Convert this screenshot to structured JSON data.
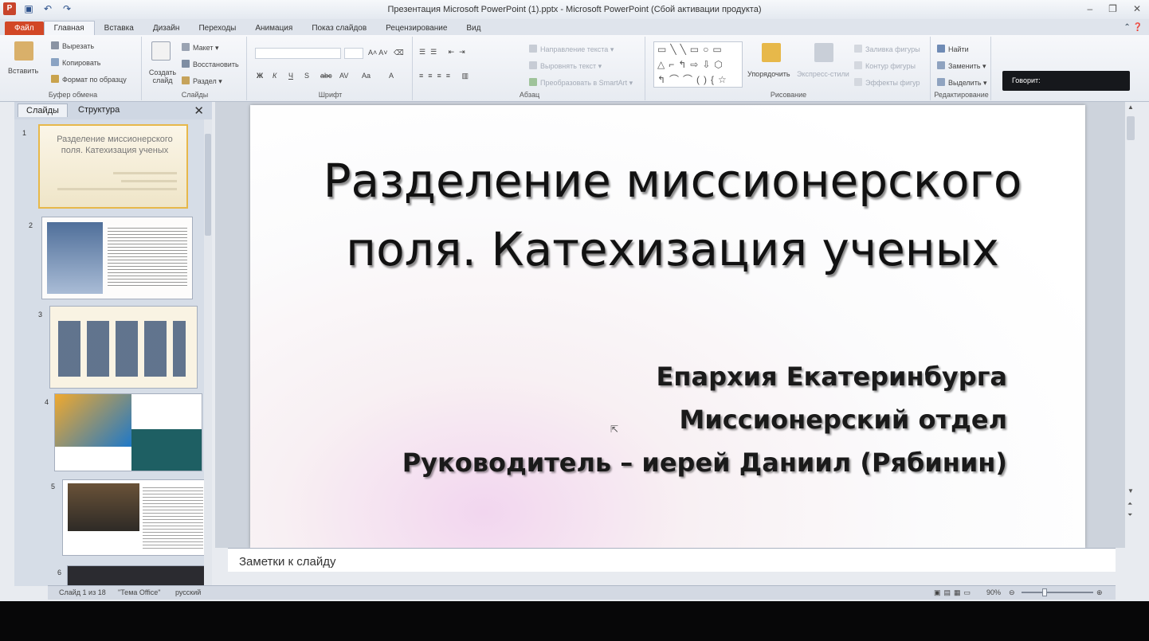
{
  "window": {
    "title": "Презентация Microsoft PowerPoint (1).pptx - Microsoft PowerPoint (Сбой активации продукта)",
    "qat": [
      "powerpoint-logo-icon",
      "save-icon",
      "undo-icon",
      "redo-icon"
    ],
    "controls": [
      "minimize-icon",
      "maximize-icon",
      "close-icon"
    ],
    "controls_glyphs": [
      "–",
      "❐",
      "✕"
    ]
  },
  "tabs": [
    "Файл",
    "Главная",
    "Вставка",
    "Дизайн",
    "Переходы",
    "Анимация",
    "Показ слайдов",
    "Рецензирование",
    "Вид"
  ],
  "active_tab": "Главная",
  "ribbon": {
    "clipboard": {
      "label": "Буфер обмена",
      "paste": "Вставить",
      "cut": "Вырезать",
      "copy": "Копировать",
      "format_painter": "Формат по образцу"
    },
    "slides": {
      "label": "Слайды",
      "new_slide": "Создать слайд",
      "layout": "Макет",
      "reset": "Восстановить",
      "section": "Раздел"
    },
    "font": {
      "label": "Шрифт",
      "buttons": [
        "Ж",
        "К",
        "Ч",
        "S",
        "abc",
        "AV",
        "Aa",
        "A"
      ]
    },
    "paragraph": {
      "label": "Абзац",
      "text_direction": "Направление текста",
      "align_text": "Выровнять текст",
      "convert_smartart": "Преобразовать в SmartArt"
    },
    "drawing": {
      "label": "Рисование",
      "arrange": "Упорядочить",
      "quick_styles": "Экспресс-стили",
      "shape_fill": "Заливка фигуры",
      "shape_outline": "Контур фигуры",
      "shape_effects": "Эффекты фигур"
    },
    "editing": {
      "label": "Редактирование",
      "find": "Найти",
      "replace": "Заменить",
      "select": "Выделить"
    }
  },
  "speaking_box": "Говорит:",
  "panel": {
    "tabs": [
      "Слайды",
      "Структура"
    ],
    "close": "✕",
    "thumbs": [
      {
        "num": "1",
        "title": "Разделение миссионерского поля. Катехизация ученых"
      },
      {
        "num": "2"
      },
      {
        "num": "3"
      },
      {
        "num": "4"
      },
      {
        "num": "5"
      },
      {
        "num": "6"
      }
    ]
  },
  "slide": {
    "title_line1": "Разделение миссионерского",
    "title_line2": "поля. Катехизация ученых",
    "sub1": "Епархия Екатеринбурга",
    "sub2": "Миссионерский отдел",
    "sub3": "Руководитель – иерей Даниил (Рябинин)"
  },
  "notes": {
    "placeholder": "Заметки к слайду"
  },
  "status": {
    "slide": "Слайд 1 из 18",
    "theme": "\"Тема Office\"",
    "language": "русский",
    "zoom": "90%"
  },
  "colors": {
    "file_tab": "#d24726",
    "selected_thumb_border": "#e7b84a",
    "ribbon_bg": "#f3f5f9"
  }
}
